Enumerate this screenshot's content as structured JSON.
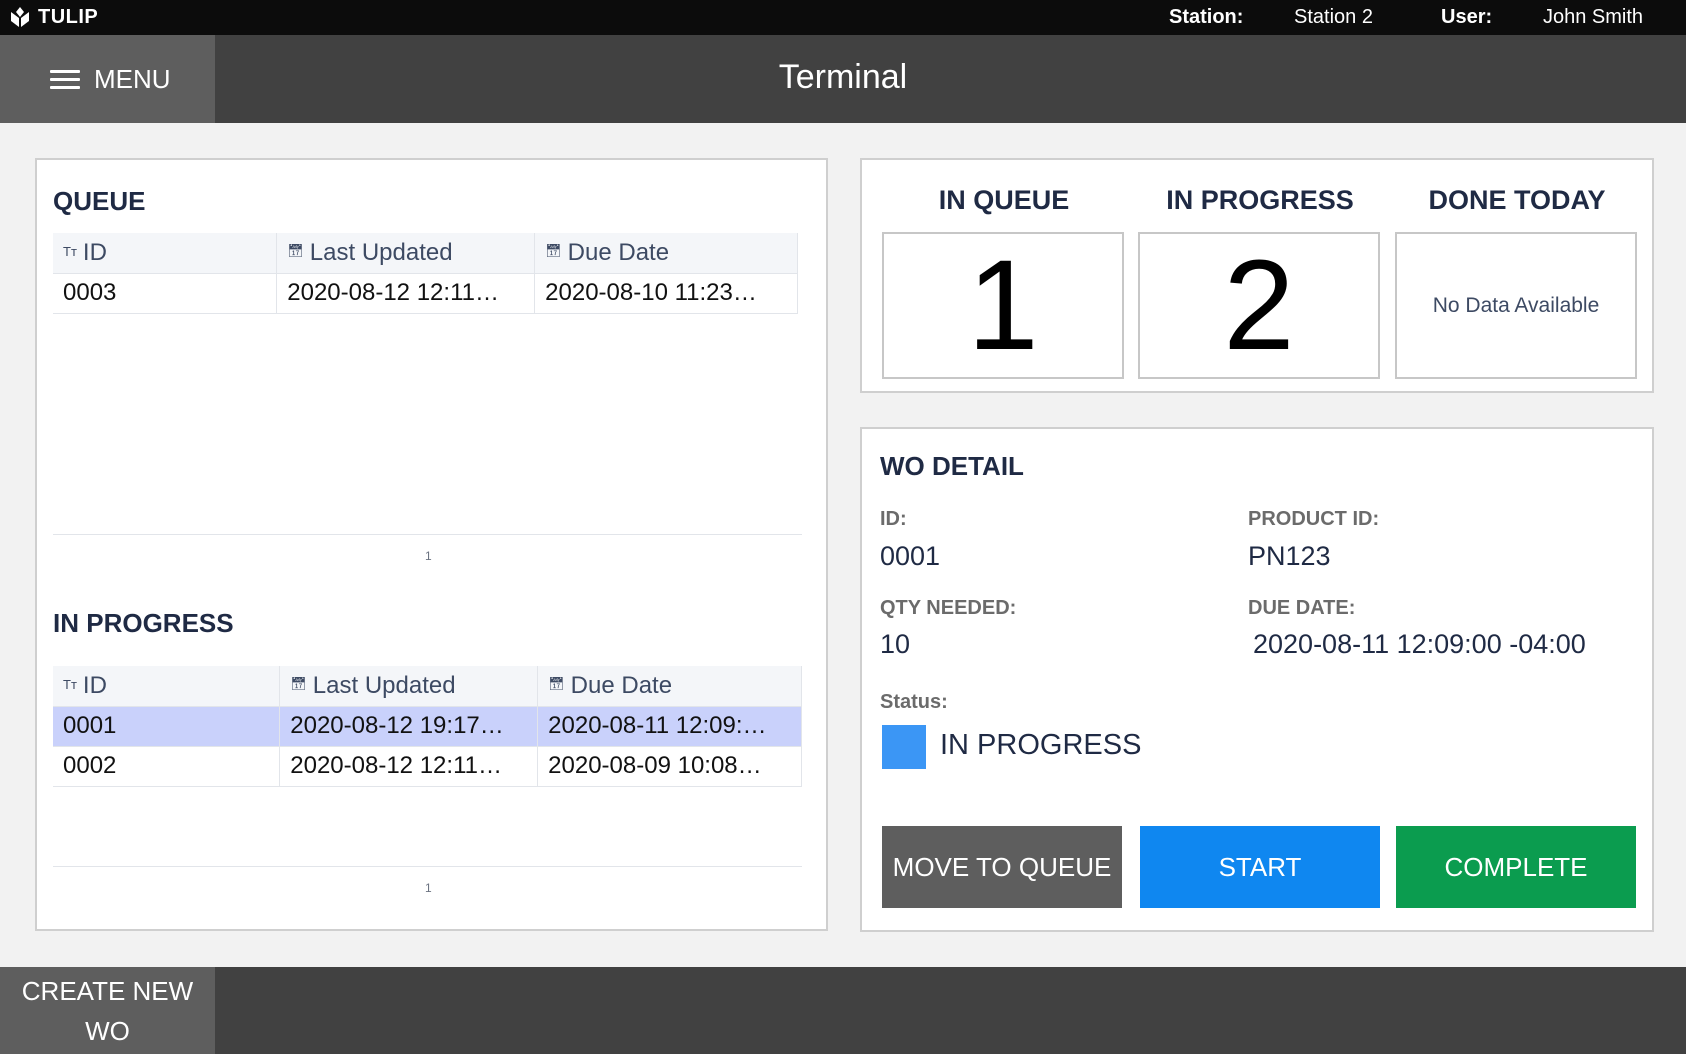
{
  "topbar": {
    "brand": "TULIP",
    "station_label": "Station:",
    "station_value": "Station 2",
    "user_label": "User:",
    "user_value": "John Smith"
  },
  "header": {
    "menu_label": "MENU",
    "title": "Terminal"
  },
  "queue": {
    "title": "QUEUE",
    "columns": [
      "ID",
      "Last Updated",
      "Due Date"
    ],
    "rows": [
      [
        "0003",
        "2020-08-12 12:11…",
        "2020-08-10 11:23…"
      ]
    ],
    "page": "1"
  },
  "in_progress": {
    "title": "IN PROGRESS",
    "columns": [
      "ID",
      "Last Updated",
      "Due Date"
    ],
    "rows": [
      [
        "0001",
        "2020-08-12 19:17…",
        "2020-08-11 12:09:…"
      ],
      [
        "0002",
        "2020-08-12 12:11…",
        "2020-08-09 10:08…"
      ]
    ],
    "page": "1"
  },
  "counters": {
    "in_queue_label": "IN QUEUE",
    "in_queue_value": "1",
    "in_progress_label": "IN PROGRESS",
    "in_progress_value": "2",
    "done_today_label": "DONE TODAY",
    "done_today_value": "No Data Available"
  },
  "wo_detail": {
    "title": "WO DETAIL",
    "id_label": "ID:",
    "id_value": "0001",
    "product_label": "PRODUCT ID:",
    "product_value": "PN123",
    "qty_label": "QTY NEEDED:",
    "qty_value": "10",
    "due_label": "DUE DATE:",
    "due_value": "2020-08-11 12:09:00 -04:00",
    "status_label": "Status:",
    "status_value": "IN PROGRESS",
    "status_color": "#3b96f5"
  },
  "actions": {
    "move_label": "MOVE TO QUEUE",
    "move_color": "#5e5e5e",
    "start_label": "START",
    "start_color": "#0f87f0",
    "complete_label": "COMPLETE",
    "complete_color": "#0b9c4f"
  },
  "footer": {
    "create_line1": "CREATE NEW",
    "create_line2": "WO"
  }
}
